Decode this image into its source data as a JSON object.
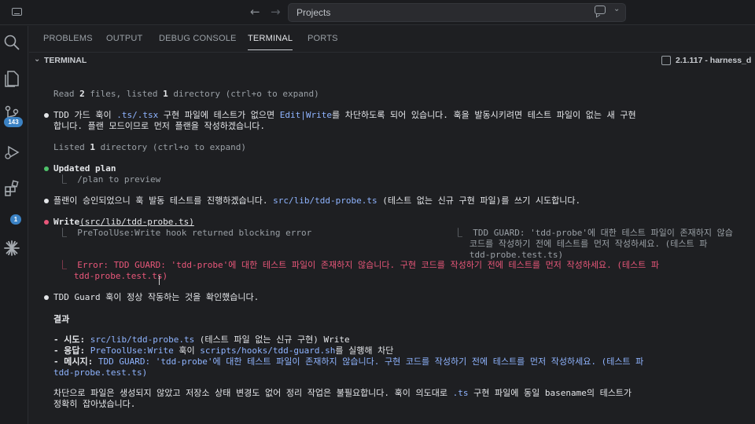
{
  "titlebar": {
    "search_label": "Projects",
    "back_icon": "←",
    "forward_icon": "→"
  },
  "activity": {
    "scm_badge": "143",
    "extensions_badge": "1"
  },
  "panel": {
    "tabs": [
      "PROBLEMS",
      "OUTPUT",
      "DEBUG CONSOLE",
      "TERMINAL",
      "PORTS"
    ],
    "active_tab": "TERMINAL",
    "section_title": "TERMINAL",
    "terminal_name": "2.1.117 - harness_d"
  },
  "terminal": {
    "l1_a": "Read ",
    "l1_b": "2",
    "l1_c": " files, listed ",
    "l1_d": "1",
    "l1_e": " directory (ctrl+o to expand)",
    "l2_a": "TDD 가드 훅이 ",
    "l2_b": ".ts/.tsx",
    "l2_c": " 구현 파일에 테스트가 없으면 ",
    "l2_d": "Edit|Write",
    "l2_e": "를 차단하도록 되어 있습니다. 훅을 발동시키려면 테스트 파일이 없는 새 구현",
    "l3": "합니다. 플랜 모드이므로 먼저 플랜을 작성하겠습니다.",
    "l4_a": "Listed ",
    "l4_b": "1",
    "l4_c": " directory (ctrl+o to expand)",
    "l5": "Updated plan",
    "l6": "⎿  /plan to preview",
    "l7_a": "플랜이 승인되었으니 훅 발동 테스트를 진행하겠습니다. ",
    "l7_b": "src/lib/tdd-probe.ts",
    "l7_c": " (테스트 없는 신규 구현 파일)를 쓰기 시도합니다.",
    "l8_a": "Write",
    "l8_b": "(src/lib/tdd-probe.ts)",
    "l9": "⎿  PreToolUse:Write hook returned blocking error",
    "r1": "⎿  TDD GUARD: 'tdd-probe'에 대한 테스트 파일이 존재하지 않습",
    "r2": "   코드를 작성하기 전에 테스트를 먼저 작성하세요. (테스트 파",
    "r3": "   tdd-probe.test.ts)",
    "e1": "⎿  Error: TDD GUARD: 'tdd-probe'에 대한 테스트 파일이 존재하지 않습니다. 구현 코드를 작성하기 전에 테스트를 먼저 작성하세요. (테스트 파",
    "e2": "   tdd-probe.test.ts)",
    "l10": "TDD Guard 훅이 정상 작동하는 것을 확인했습니다.",
    "l11": "결과",
    "b1_a": "- 시도: ",
    "b1_b": "src/lib/tdd-probe.ts",
    "b1_c": " (테스트 파일 없는 신규 구현) Write",
    "b2_a": "- 응답: ",
    "b2_b": "PreToolUse:Write",
    "b2_c": " 훅이 ",
    "b2_d": "scripts/hooks/tdd-guard.sh",
    "b2_e": "를 실행해 차단",
    "b3_a": "- 메시지: ",
    "b3_b": "TDD GUARD: 'tdd-probe'에 대한 테스트 파일이 존재하지 않습니다. 구현 코드를 작성하기 전에 테스트를 먼저 작성하세요. (테스트 파",
    "b4": "tdd-probe.test.ts)",
    "l12_a": "차단으로 파일은 생성되지 않았고 저장소 상태 변경도 없어 정리 작업은 불필요합니다. 훅이 의도대로 ",
    "l12_b": ".ts",
    "l12_c": " 구현 파일에 동일 basename의 테스트가",
    "l13": "정확히 잡아냈습니다."
  }
}
